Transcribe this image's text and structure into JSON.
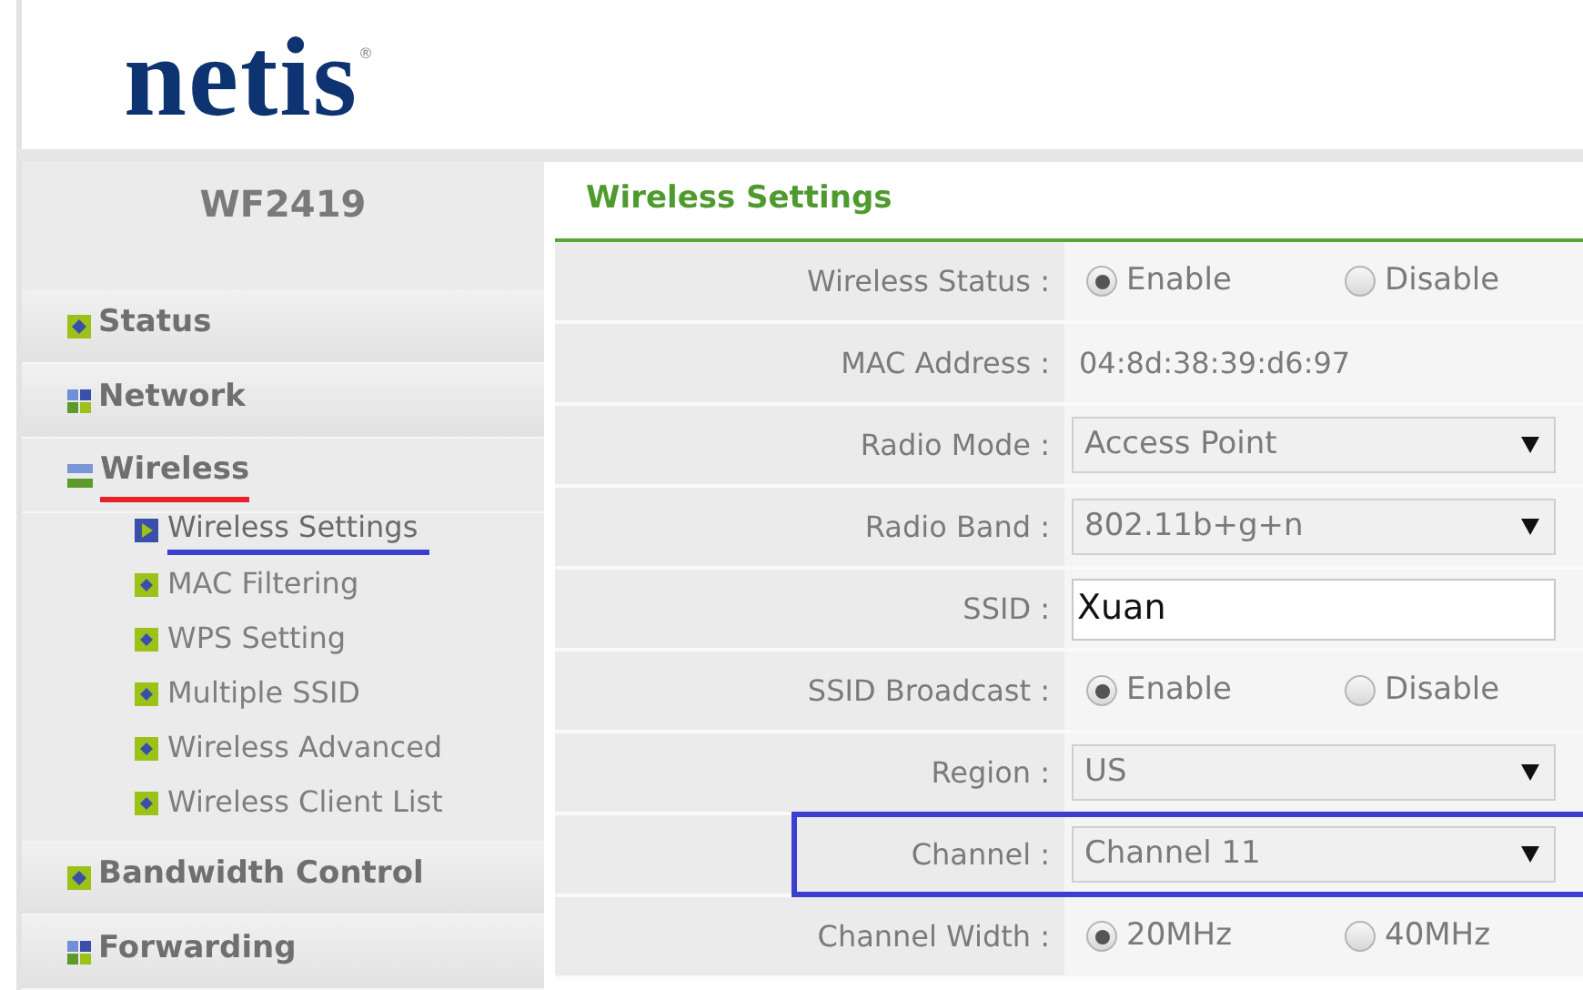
{
  "logo": {
    "text": "netis",
    "mark": "®"
  },
  "sidebar": {
    "title": "WF2419",
    "items": [
      {
        "kind": "page",
        "label": "Status"
      },
      {
        "kind": "group",
        "label": "Network",
        "expanded": false
      },
      {
        "kind": "group",
        "label": "Wireless",
        "expanded": true,
        "underlined": true,
        "children": [
          {
            "label": "Wireless Settings",
            "selected": true,
            "underlined": true
          },
          {
            "label": "MAC Filtering",
            "selected": false
          },
          {
            "label": "WPS Setting",
            "selected": false
          },
          {
            "label": "Multiple SSID",
            "selected": false
          },
          {
            "label": "Wireless Advanced",
            "selected": false
          },
          {
            "label": "Wireless Client List",
            "selected": false
          }
        ]
      },
      {
        "kind": "page",
        "label": "Bandwidth Control"
      },
      {
        "kind": "group",
        "label": "Forwarding",
        "expanded": false
      }
    ]
  },
  "panel": {
    "title": "Wireless Settings",
    "rows": [
      {
        "kind": "radio",
        "label": "Wireless Status :",
        "options": [
          {
            "label": "Enable",
            "selected": true
          },
          {
            "label": "Disable",
            "selected": false
          }
        ]
      },
      {
        "kind": "text",
        "label": "MAC Address :",
        "value": "04:8d:38:39:d6:97"
      },
      {
        "kind": "select",
        "label": "Radio Mode :",
        "value": "Access Point"
      },
      {
        "kind": "select",
        "label": "Radio Band :",
        "value": "802.11b+g+n"
      },
      {
        "kind": "input",
        "label": "SSID :",
        "value": "Xuan"
      },
      {
        "kind": "radio",
        "label": "SSID Broadcast :",
        "options": [
          {
            "label": "Enable",
            "selected": true
          },
          {
            "label": "Disable",
            "selected": false
          }
        ]
      },
      {
        "kind": "select",
        "label": "Region :",
        "value": "US"
      },
      {
        "kind": "select",
        "label": "Channel :",
        "value": "Channel 11",
        "outlined": true
      },
      {
        "kind": "radio",
        "label": "Channel Width :",
        "options": [
          {
            "label": "20MHz",
            "selected": true
          },
          {
            "label": "40MHz",
            "selected": false
          }
        ]
      }
    ]
  }
}
